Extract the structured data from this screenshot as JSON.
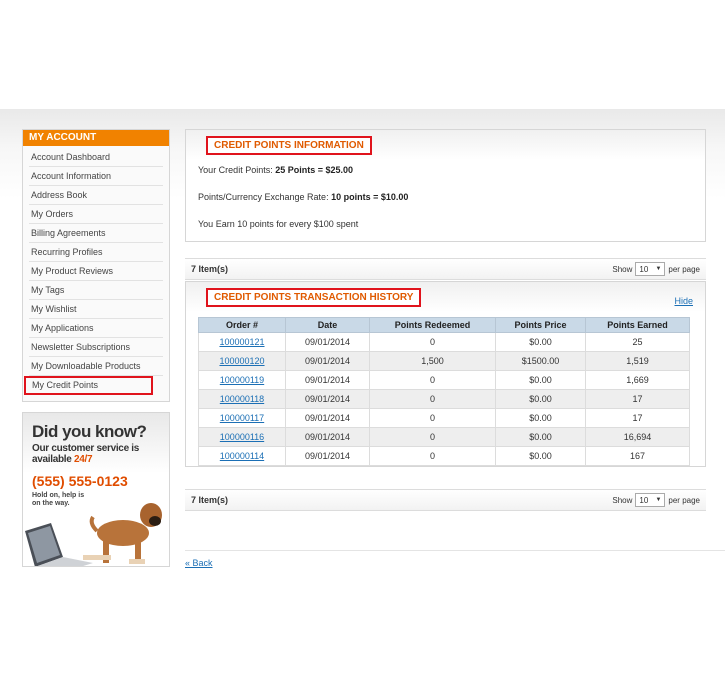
{
  "sidebar": {
    "title": "MY ACCOUNT",
    "items": [
      {
        "label": "Account Dashboard"
      },
      {
        "label": "Account Information"
      },
      {
        "label": "Address Book"
      },
      {
        "label": "My Orders"
      },
      {
        "label": "Billing Agreements"
      },
      {
        "label": "Recurring Profiles"
      },
      {
        "label": "My Product Reviews"
      },
      {
        "label": "My Tags"
      },
      {
        "label": "My Wishlist"
      },
      {
        "label": "My Applications"
      },
      {
        "label": "Newsletter Subscriptions"
      },
      {
        "label": "My Downloadable Products"
      },
      {
        "label": "My Credit Points",
        "active": true
      }
    ]
  },
  "promo": {
    "title": "Did you know?",
    "line1": "Our customer service is available ",
    "line1_highlight": "24/7",
    "phone": "(555) 555-0123",
    "hold": "Hold on, help is on the way."
  },
  "info": {
    "title": "CREDIT POINTS INFORMATION",
    "credit_label": "Your Credit Points: ",
    "credit_value": "25 Points = $25.00",
    "rate_label": "Points/Currency Exchange Rate: ",
    "rate_value": "10 points = $10.00",
    "earn_text": "You Earn 10 points for every $100 spent"
  },
  "pager_top": {
    "count": "7 Item(s)",
    "show_label": "Show",
    "show_value": "10",
    "per_page": "per page"
  },
  "pager_bottom": {
    "count": "7 Item(s)",
    "show_label": "Show",
    "show_value": "10",
    "per_page": "per page"
  },
  "history": {
    "title": "CREDIT POINTS TRANSACTION HISTORY",
    "hide_label": "Hide",
    "columns": [
      "Order #",
      "Date",
      "Points Redeemed",
      "Points Price",
      "Points Earned"
    ],
    "rows": [
      {
        "order": "100000121",
        "date": "09/01/2014",
        "redeemed": "0",
        "price": "$0.00",
        "earned": "25"
      },
      {
        "order": "100000120",
        "date": "09/01/2014",
        "redeemed": "1,500",
        "price": "$1500.00",
        "earned": "1,519"
      },
      {
        "order": "100000119",
        "date": "09/01/2014",
        "redeemed": "0",
        "price": "$0.00",
        "earned": "1,669"
      },
      {
        "order": "100000118",
        "date": "09/01/2014",
        "redeemed": "0",
        "price": "$0.00",
        "earned": "17"
      },
      {
        "order": "100000117",
        "date": "09/01/2014",
        "redeemed": "0",
        "price": "$0.00",
        "earned": "17"
      },
      {
        "order": "100000116",
        "date": "09/01/2014",
        "redeemed": "0",
        "price": "$0.00",
        "earned": "16,694"
      },
      {
        "order": "100000114",
        "date": "09/01/2014",
        "redeemed": "0",
        "price": "$0.00",
        "earned": "167"
      }
    ]
  },
  "back_label": "« Back",
  "colors": {
    "accent": "#f18200",
    "highlight_border": "#e0131c",
    "link": "#1b6fb5",
    "table_header": "#c9d9e7"
  }
}
